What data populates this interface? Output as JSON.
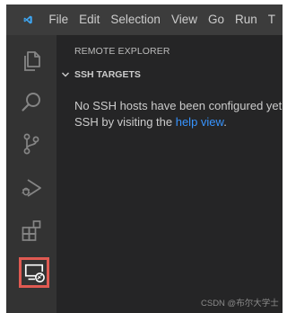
{
  "colors": {
    "titlebar_bg": "#3c3c3c",
    "activitybar_bg": "#333333",
    "sidebar_bg": "#252526",
    "icon_color": "#858585",
    "active_icon_color": "#ffffff",
    "highlight_border": "#e05a52",
    "link": "#3794ff",
    "text": "#cccccc"
  },
  "titlebar": {
    "logo_icon": "vscode-logo-icon",
    "menu": [
      "File",
      "Edit",
      "Selection",
      "View",
      "Go",
      "Run",
      "T"
    ]
  },
  "activity_bar": {
    "items": [
      {
        "icon": "files-icon"
      },
      {
        "icon": "search-icon"
      },
      {
        "icon": "source-control-icon"
      },
      {
        "icon": "run-debug-icon"
      },
      {
        "icon": "extensions-icon"
      },
      {
        "icon": "remote-explorer-icon",
        "active": true,
        "highlighted": true
      }
    ]
  },
  "sidebar": {
    "title": "REMOTE EXPLORER",
    "section": {
      "title": "SSH TARGETS",
      "expanded": true
    },
    "message_line1": "No SSH hosts have been configured yet.",
    "message_line2_prefix": "SSH by visiting the ",
    "help_link": "help view",
    "message_line2_suffix": "."
  },
  "watermark": "CSDN @布尔大学士"
}
